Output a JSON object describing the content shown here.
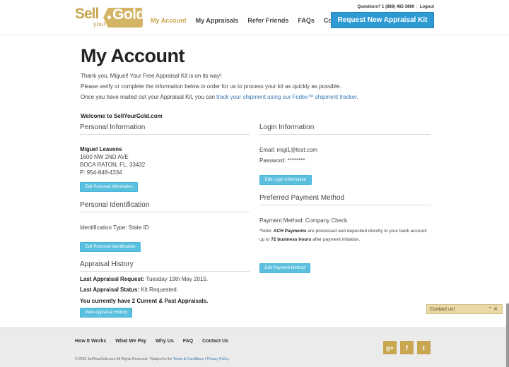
{
  "header": {
    "logo": {
      "sell": "Sell",
      "your": "your",
      "gold": "Gold"
    },
    "nav": [
      "My Account",
      "My Appraisals",
      "Refer Friends",
      "FAQs",
      "Contact Us"
    ],
    "questions": "Questions? 1 (888) 465-3860",
    "logout": "Logout",
    "cta": "Request New Appraisal Kit"
  },
  "main": {
    "title": "My Account",
    "intro1": "Thank you, Miguel! Your Free Appraisal Kit is on its way!",
    "intro2": "Please verify or complete the information below in order for us to process your kit as quickly as possible.",
    "intro3_prefix": "Once you have mailed out your Appraisal Kit, you can ",
    "intro3_link": "track your shipment using our Fedex™ shipment tracker",
    "intro3_suffix": ".",
    "welcome": "Welcome to SellYourGold.com"
  },
  "personal": {
    "heading": "Personal Information",
    "name": "Miguel Leavens",
    "address1": "1600 NW 2ND AVE",
    "address2": "BOCA RATON, FL, 33432",
    "phone": "P: 954-848-4334",
    "button": "Edit Personal Information"
  },
  "identification": {
    "heading": "Personal Identification",
    "type": "Identification Type: State ID",
    "button": "Edit Personal Identification"
  },
  "appraisal": {
    "heading": "Appraisal History",
    "request_label": "Last Appraisal Request:",
    "request_value": " Tuesday 19th May 2015.",
    "status_label": "Last Appraisal Status:",
    "status_value": " Kit Requested.",
    "current": "You currently have 2 Current & Past Appraisals.",
    "button": "View Appraisal History"
  },
  "login": {
    "heading": "Login Information",
    "email": "Email: migl1@test.com",
    "password": "Password: ********",
    "button": "Edit Login Information"
  },
  "payment": {
    "heading": "Preferred Payment Method",
    "method": "Payment Method: Company Check",
    "note_prefix": "*Note: ",
    "note_bold1": "ACH Payments",
    "note_mid": " are processed and deposited directly to your bank account up to ",
    "note_bold2": "72 business hours",
    "note_suffix": " after payment initiation.",
    "button": "Edit Payment Method"
  },
  "contact_widget": {
    "label": "Contact us!",
    "icons": [
      "chevron-up-icon",
      "close-icon"
    ]
  },
  "footer": {
    "nav": [
      "How It Works",
      "What We Pay",
      "Why Us",
      "FAQ",
      "Contact Us"
    ],
    "copyright_prefix": "© 2015 SellYourGold.com All Rights Reserved. *Subject to the ",
    "terms": "Terms & Conditions",
    "sep": " | ",
    "privacy": "Privacy Policy",
    "copyright_suffix": ".",
    "social": [
      "google-plus-icon",
      "facebook-icon",
      "twitter-icon"
    ]
  },
  "colors": {
    "gold": "#c9a650",
    "blue_cta": "#2e9ad3",
    "btn": "#5bc0de"
  }
}
